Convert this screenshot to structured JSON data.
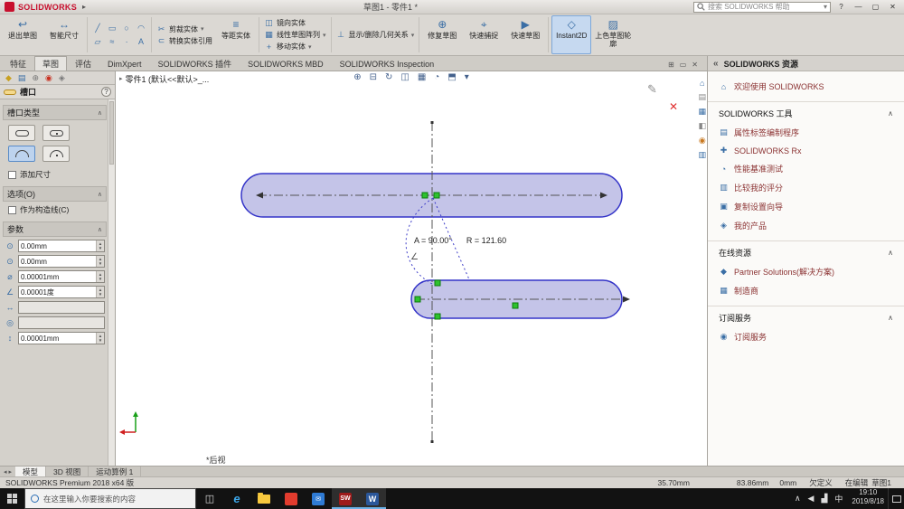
{
  "titlebar": {
    "brand": "SOLIDWORKS",
    "title": "草图1 - 零件1 *",
    "search_placeholder": "搜索 SOLIDWORKS 帮助",
    "help": "?",
    "min": "—",
    "max": "▢",
    "close": "✕"
  },
  "ribbon": {
    "exit_sketch": "退出草图",
    "smart_dimension": "智能尺寸",
    "trim": "剪裁实体",
    "convert": "转换实体引用",
    "offset": "等距实体",
    "mirror": "镜向实体",
    "linear_pattern": "线性草图阵列",
    "move": "移动实体",
    "relations": "显示/删除几何关系",
    "repair": "修复草图",
    "quick_snaps": "快速捕捉",
    "rapid_sketch": "快速草图",
    "instant2d": "Instant2D",
    "shaded_contours": "上色草图轮廓"
  },
  "tabs": {
    "items": [
      "特征",
      "草图",
      "评估",
      "DimXpert",
      "SOLIDWORKS 插件",
      "SOLIDWORKS MBD",
      "SOLIDWORKS Inspection"
    ],
    "active": "草图"
  },
  "property_manager": {
    "title": "槽口",
    "slot_type_header": "槽口类型",
    "add_dimension": "添加尺寸",
    "options_header": "选项(O)",
    "construction": "作为构造线(C)",
    "parameters_header": "参数",
    "params": [
      "0.00mm",
      "0.00mm",
      "0.00001mm",
      "0.00001度",
      "",
      "",
      "0.00001mm"
    ]
  },
  "viewport": {
    "doc_node": "零件1 (默认<<默认>_...",
    "angle_label": "A = 90.00°",
    "radius_label": "R = 121.60",
    "view_label": "*后视"
  },
  "task_pane": {
    "header": "SOLIDWORKS 资源",
    "welcome": "欢迎使用 SOLIDWORKS",
    "tools_header": "SOLIDWORKS 工具",
    "tools": [
      "属性标签编制程序",
      "SOLIDWORKS Rx",
      "性能基准测试",
      "比较我的评分",
      "复制设置向导",
      "我的产品"
    ],
    "online_header": "在线资源",
    "online": [
      "Partner Solutions(解决方案)",
      "制造商"
    ],
    "subscription_header": "订阅服务",
    "subscription": [
      "订阅服务"
    ]
  },
  "bottom": {
    "model_tabs": [
      "模型",
      "3D 视图",
      "运动算例 1"
    ],
    "status_left": "SOLIDWORKS Premium 2018 x64 版",
    "coord_x": "35.70mm",
    "coord_y": "83.86mm",
    "coord_z": "0mm",
    "state": "欠定义",
    "editing": "在编辑",
    "editing_target": "草图1"
  },
  "taskbar": {
    "search_placeholder": "在这里输入你要搜索的内容",
    "ime": "中",
    "time": "19:10",
    "date": "2019/8/18"
  }
}
